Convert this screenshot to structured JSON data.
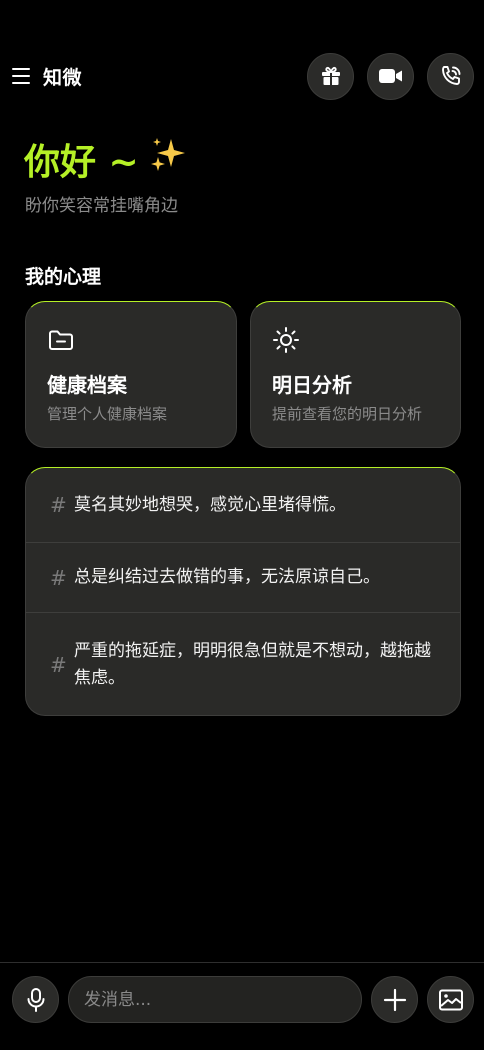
{
  "header": {
    "app_title": "知微",
    "icons": {
      "menu": "menu-icon",
      "gift": "gift-icon",
      "video": "video-icon",
      "call": "phone-call-icon"
    }
  },
  "greeting": {
    "title": "你好 ~",
    "emoji": "sparkles-icon",
    "subtitle": "盼你笑容常挂嘴角边"
  },
  "section": {
    "title": "我的心理"
  },
  "cards": [
    {
      "icon": "folder-icon",
      "title": "健康档案",
      "description": "管理个人健康档案"
    },
    {
      "icon": "sun-icon",
      "title": "明日分析",
      "description": "提前查看您的明日分析"
    }
  ],
  "topics": [
    {
      "hash": "#",
      "text": "莫名其妙地想哭，感觉心里堵得慌。"
    },
    {
      "hash": "#",
      "text": "总是纠结过去做错的事，无法原谅自己。"
    },
    {
      "hash": "#",
      "text": "严重的拖延症，明明很急但就是不想动，越拖越焦虑。"
    }
  ],
  "composer": {
    "placeholder": "发消息...",
    "value": ""
  },
  "colors": {
    "accent": "#b5f026",
    "background": "#000000",
    "surface": "#2a2a28",
    "muted_text": "#8b8b8b"
  }
}
